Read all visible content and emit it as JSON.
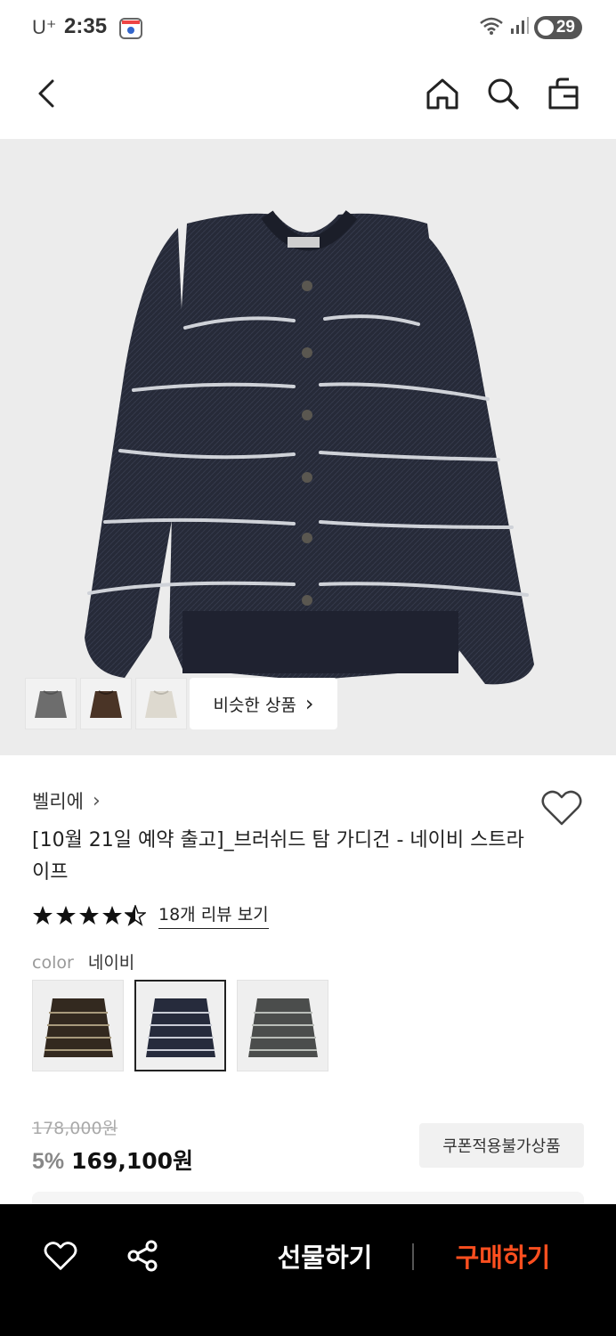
{
  "status_bar": {
    "carrier": "U⁺",
    "time": "2:35",
    "battery": "29"
  },
  "header": {
    "back_icon": "back-icon",
    "home_icon": "home-icon",
    "search_icon": "search-icon",
    "bag_icon": "bag-icon"
  },
  "hero": {
    "image": "navy-striped-cardigan",
    "thumbnails": [
      "grey-sweater",
      "brown-sweater",
      "ivory-sweater"
    ],
    "similar_button": "비슷한 상품",
    "similar_chevron": "›"
  },
  "product": {
    "brand": "벨리에",
    "brand_chevron": "›",
    "title": "[10월 21일 예약 출고]_브러쉬드 탐 가디건 - 네이비 스트라이프",
    "rating": 4.5,
    "review_link": "18개 리뷰 보기",
    "color_label": "color",
    "color_value": "네이비",
    "color_options": [
      {
        "name": "brown-stripe",
        "selected": false
      },
      {
        "name": "navy-stripe",
        "selected": true
      },
      {
        "name": "grey-stripe",
        "selected": false
      }
    ],
    "original_price": "178,000원",
    "discount": "5%",
    "price": "169,100원",
    "coupon_badge": "쿠폰적용불가상품"
  },
  "bottom_bar": {
    "gift_button": "선물하기",
    "buy_button": "구매하기",
    "buy_color": "#ff4f1f"
  }
}
